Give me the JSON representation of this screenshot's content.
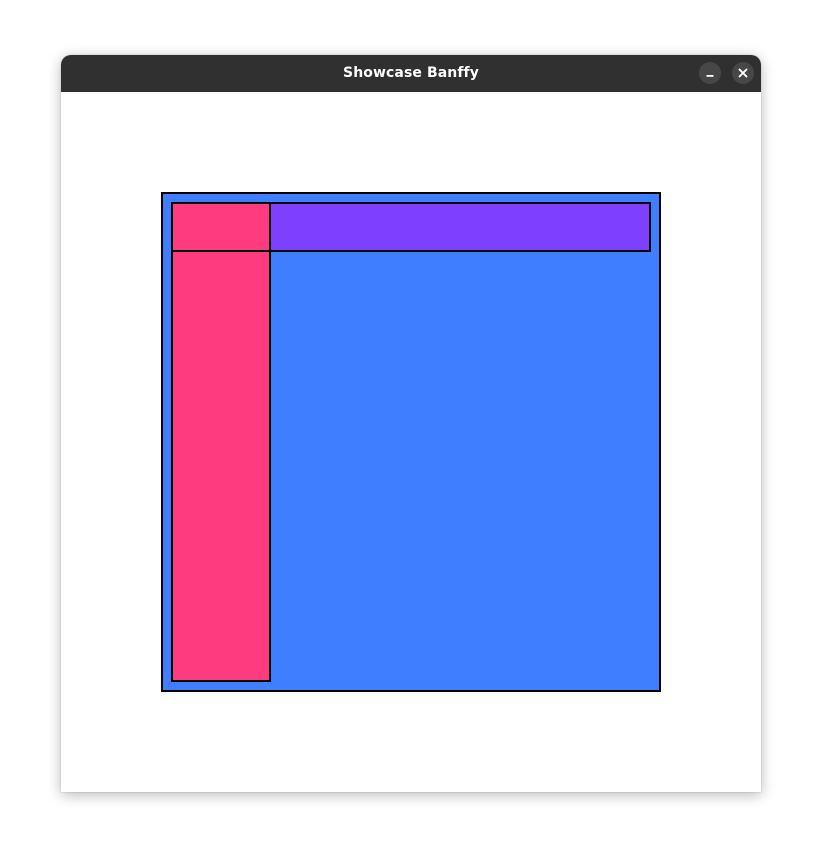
{
  "window": {
    "title": "Showcase Banffy",
    "controls": {
      "minimize_icon": "minimize-icon",
      "close_icon": "close-icon"
    }
  },
  "canvas": {
    "panels": [
      {
        "name": "container-panel",
        "color": "#3f7fff"
      },
      {
        "name": "left-panel",
        "color": "#ff3b7f"
      },
      {
        "name": "top-panel",
        "color": "#7f3fff"
      }
    ]
  }
}
